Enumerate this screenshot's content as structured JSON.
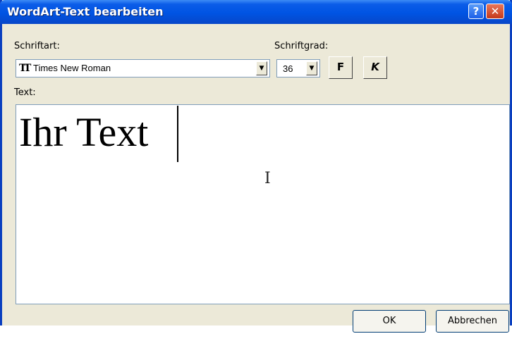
{
  "window": {
    "title": "WordArt-Text bearbeiten",
    "help_label": "?",
    "close_label": "✕"
  },
  "font": {
    "label": "Schriftart:",
    "glyph": "TT",
    "value": "Times New Roman"
  },
  "size": {
    "label": "Schriftgrad:",
    "value": "36"
  },
  "format": {
    "bold_label": "F",
    "italic_label": "K"
  },
  "text": {
    "label": "Text:",
    "content": "Ihr Text"
  },
  "buttons": {
    "ok_label": "OK",
    "cancel_label": "Abbrechen"
  },
  "colors": {
    "titlebar": "#0054e3",
    "dialog_bg": "#ece9d8"
  }
}
